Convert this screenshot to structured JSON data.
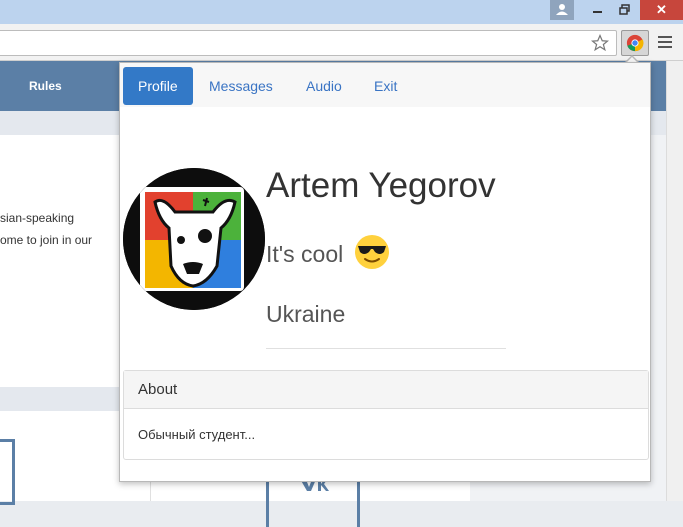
{
  "browser": {
    "close_glyph": "✕"
  },
  "page": {
    "nav_rules": "Rules",
    "text_lines": [
      "sian-speaking",
      "ome to join in our"
    ]
  },
  "popup": {
    "tabs": [
      {
        "label": "Profile",
        "active": true
      },
      {
        "label": "Messages",
        "active": false
      },
      {
        "label": "Audio",
        "active": false
      },
      {
        "label": "Exit",
        "active": false
      }
    ],
    "profile": {
      "name": "Artem Yegorov",
      "status": "It's cool",
      "status_emoji": "sunglasses-emoji-icon",
      "location": "Ukraine"
    },
    "about": {
      "title": "About",
      "text": "Обычный студент..."
    }
  },
  "colors": {
    "accent": "#3379c7",
    "header": "#5b7fa6",
    "close": "#c7463c"
  }
}
